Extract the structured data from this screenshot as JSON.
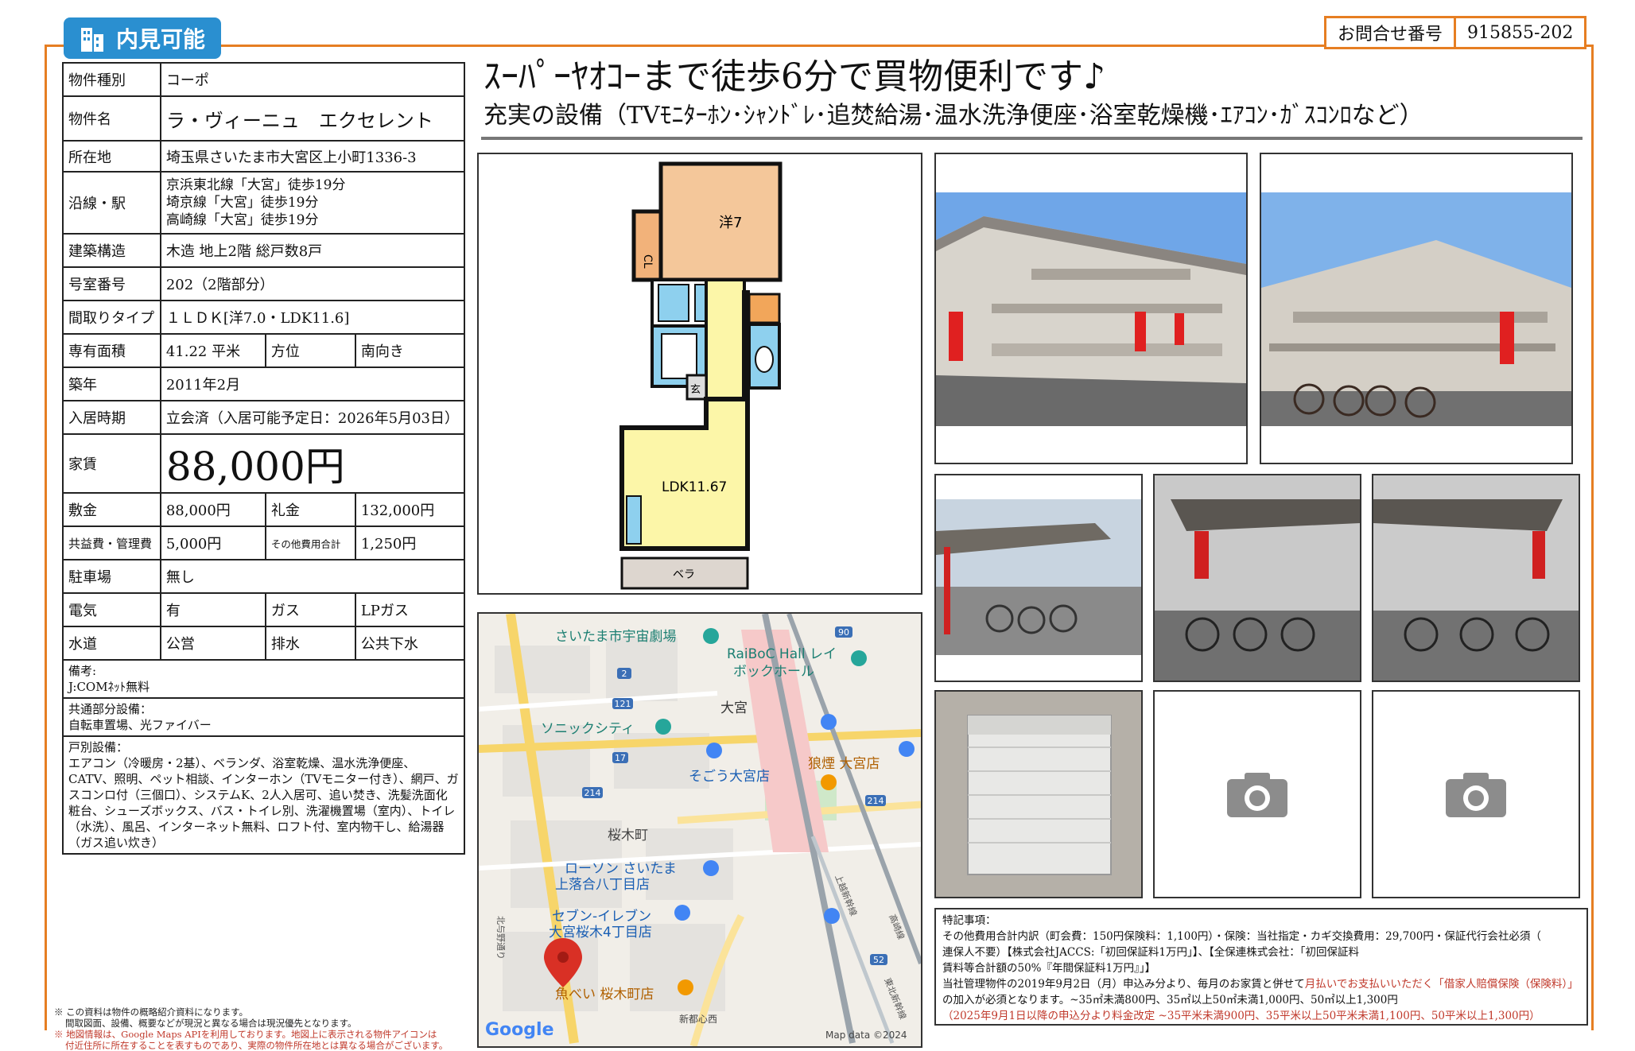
{
  "header": {
    "badge_label": "内見可能",
    "inquiry_label": "お問合せ番号",
    "inquiry_number": "915855-202"
  },
  "property": {
    "type_label": "物件種別",
    "type_value": "コーポ",
    "name_label": "物件名",
    "name_value": "ラ・ヴィーニュ　エクセレント",
    "address_label": "所在地",
    "address_value": "埼玉県さいたま市大宮区上小町1336-3",
    "station_label": "沿線・駅",
    "stations": [
      "京浜東北線「大宮」徒歩19分",
      "埼京線「大宮」徒歩19分",
      "高崎線「大宮」徒歩19分"
    ],
    "structure_label": "建築構造",
    "structure_value": "木造 地上2階 総戸数8戸",
    "room_label": "号室番号",
    "room_value": "202（2階部分）",
    "layout_label": "間取りタイプ",
    "layout_value": "１ＬＤＫ[洋7.0・LDK11.6]",
    "area_label": "専有面積",
    "area_value": "41.22 平米",
    "direction_label": "方位",
    "direction_value": "南向き",
    "built_label": "築年",
    "built_value": "2011年2月",
    "movein_label": "入居時期",
    "movein_value": "立会済（入居可能予定日：2026年5月03日）",
    "rent_label": "家賃",
    "rent_value": "88,000円",
    "deposit_label": "敷金",
    "deposit_value": "88,000円",
    "keymoney_label": "礼金",
    "keymoney_value": "132,000円",
    "mgmt_label": "共益費・管理費",
    "mgmt_value": "5,000円",
    "other_label": "その他費用合計",
    "other_value": "1,250円",
    "parking_label": "駐車場",
    "parking_value": "無し",
    "electric_label": "電気",
    "electric_value": "有",
    "gas_label": "ガス",
    "gas_value": "LPガス",
    "water_label": "水道",
    "water_value": "公営",
    "drain_label": "排水",
    "drain_value": "公共下水",
    "remarks_label": "備考:",
    "remarks_value": "J:COMﾈｯﾄ無料",
    "common_label": "共通部分設備：",
    "common_value": "自転車置場、光ファイバー",
    "unit_label": "戸別設備：",
    "unit_value": "エアコン（冷暖房・2基）、ベランダ、浴室乾燥、温水洗浄便座、CATV、照明、ペット相談、インターホン（TVモニター付き）、網戸、ガスコンロ付（三個口）、システムK、2人入居可、追い焚き、洗髪洗面化粧台、シューズボックス、バス・トイレ別、洗濯機置場（室内）、トイレ（水洗）、風呂、インターネット無料、ロフト付、室内物干し、給湯器（ガス追い炊き）"
  },
  "disclaimer": {
    "line1": "※ この資料は物件の概略紹介資料になります。",
    "line2": "間取図面、設備、概要などが現況と異なる場合は現況優先となります。",
    "line3": "※ 地図情報は、Google Maps APIを利用しております。地図上に表示される物件アイコンは",
    "line4": "付近住所に所在することを表すものであり、実際の物件所在地とは異なる場合がございます。"
  },
  "headline": {
    "main": "ｽｰﾊﾟｰﾔｵｺｰまで徒歩6分で買物便利です♪",
    "sub": "充実の設備（TVﾓﾆﾀｰﾎﾝ･ｼｬﾝﾄﾞﾚ･追焚給湯･温水洗浄便座･浴室乾燥機･ｴｱｺﾝ･ｶﾞｽｺﾝﾛなど）"
  },
  "floorplan": {
    "room_western": "洋7",
    "closet": "CL",
    "entrance": "玄",
    "ldk": "LDK11.67",
    "balcony": "ベラ"
  },
  "map": {
    "labels": [
      "さいたま市宇宙劇場",
      "RaiBoC Hall レイ",
      "ボックホール",
      "大宮",
      "ソニックシティ",
      "そごう大宮店",
      "狼煙 大宮店",
      "桜木町",
      "ローソン さいたま",
      "上落合八丁目店",
      "セブン-イレブン",
      "大宮桜木4丁目店",
      "魚べい 桜木町店",
      "新都心西",
      "Google",
      "Map data ©2024"
    ],
    "route_numbers": [
      "90",
      "2",
      "121",
      "17",
      "214",
      "214",
      "52"
    ],
    "road_names": [
      "北与野通り",
      "高崎線",
      "上越新幹線",
      "東北新幹線"
    ]
  },
  "remarks": {
    "title": "特記事項：",
    "line1": "その他費用合計内訳（町会費：150円保険料：1,100円）・保険：当社指定・カギ交換費用：29,700円・保証代行会社必須（",
    "line2": "連保人不要）【株式会社JACCS:「初回保証料1万円」】、【全保連株式会社：「初回保証料",
    "line3": "賃料等合計額の50%『年間保証料1万円』」】",
    "line4_a": "当社管理物件の2019年9月2日（月）申込み分より、毎月のお家賃と併せて",
    "line4_b": "月払いでお支払いいただく「借家人賠償保険（保険料）」",
    "line5": "の加入が必須となります。~35㎡未満800円、35㎡以上50㎡未満1,000円、50㎡以上1,300円",
    "line6": "（2025年9月1日以降の申込分より料金改定 ~35平米未満900円、35平米以上50平米未満1,100円、50平米以上1,300円）"
  },
  "colors": {
    "accent_orange": "#e67e22",
    "badge_blue": "#2a8fd0",
    "note_red": "#c0392b"
  }
}
